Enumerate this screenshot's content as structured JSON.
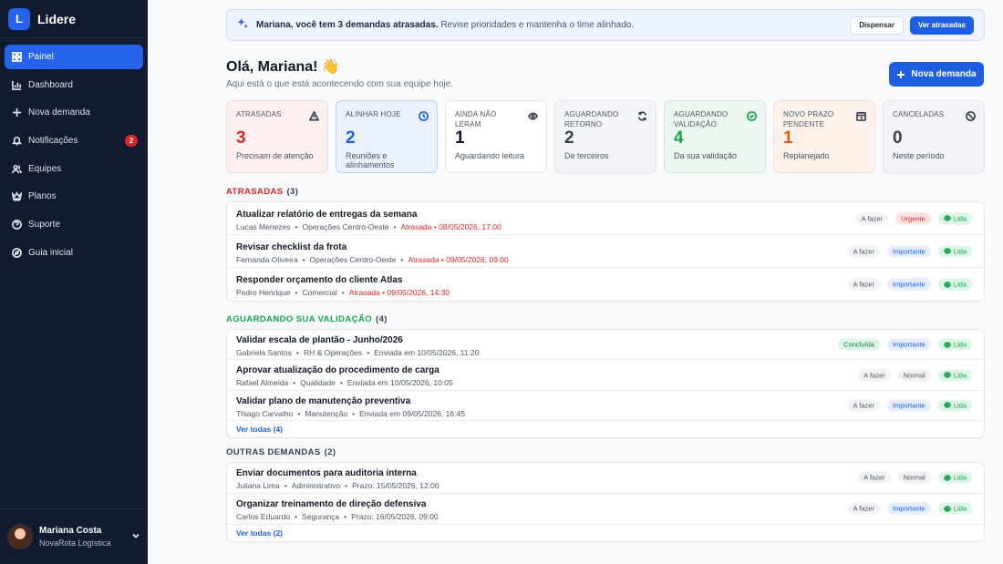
{
  "brand": {
    "logo_letter": "L",
    "name": "Lidere"
  },
  "sidebar": {
    "items": [
      {
        "label": "Painel",
        "icon": "grid-icon",
        "active": true
      },
      {
        "label": "Dashboard",
        "icon": "bar-chart-icon"
      },
      {
        "label": "Nova demanda",
        "icon": "plus-icon"
      },
      {
        "label": "Notificações",
        "icon": "bell-icon",
        "badge": "2"
      },
      {
        "label": "Equipes",
        "icon": "users-icon"
      },
      {
        "label": "Planos",
        "icon": "crown-icon"
      },
      {
        "label": "Suporte",
        "icon": "help-icon"
      },
      {
        "label": "Guia inicial",
        "icon": "compass-icon"
      }
    ],
    "user": {
      "name": "Mariana Costa",
      "org": "NovaRota Logística"
    }
  },
  "banner": {
    "bold": "Mariana, você tem 3 demandas atrasadas.",
    "text": "Revise prioridades e mantenha o time alinhado.",
    "dismiss": "Dispensar",
    "view": "Ver atrasadas"
  },
  "greeting": {
    "title": "Olá, Mariana! 👋",
    "subtitle": "Aqui está o que está acontecendo com sua equipe hoje."
  },
  "new_button": "Nova demanda",
  "cards": [
    {
      "label": "ATRASADAS",
      "value": "3",
      "sub": "Precisam de atenção",
      "color": "#dc2626",
      "bg": "#fdf0ee",
      "border": "#f5dcd6"
    },
    {
      "label": "ALINHAR HOJE",
      "value": "2",
      "sub": "Reuniões e alinhamentos",
      "color": "#1d5fe0",
      "bg": "#eaf1fc",
      "border": "#b9cdf3"
    },
    {
      "label": "AINDA NÃO LERAM",
      "value": "1",
      "sub": "Aguardando leitura",
      "color": "#111827",
      "bg": "#ffffff",
      "border": "#e3e6eb"
    },
    {
      "label": "AGUARDANDO RETORNO",
      "value": "2",
      "sub": "De terceiros",
      "color": "#374151",
      "bg": "#f2f4f7",
      "border": "#e3e6eb"
    },
    {
      "label": "AGUARDANDO VALIDAÇÃO",
      "value": "4",
      "sub": "Da sua validação",
      "color": "#16a34a",
      "bg": "#ecf7f0",
      "border": "#cdeadb"
    },
    {
      "label": "NOVO PRAZO PENDENTE",
      "value": "1",
      "sub": "Replanejado",
      "color": "#ea580c",
      "bg": "#fdf2ea",
      "border": "#f5decb"
    },
    {
      "label": "CANCELADAS",
      "value": "0",
      "sub": "Neste período",
      "color": "#374151",
      "bg": "#f2f4f7",
      "border": "#e3e6eb"
    }
  ],
  "sections": {
    "late": {
      "title": "ATRASADAS",
      "count": "(3)",
      "color": "#dc2626",
      "rows": [
        {
          "title": "Atualizar relatório de entregas da semana",
          "person": "Lucas Menezes",
          "team": "Operações Centro-Oeste",
          "status": "Atrasada • 08/05/2026, 17:00",
          "tags": [
            "A fazer",
            "Urgente",
            "Lida"
          ]
        },
        {
          "title": "Revisar checklist da frota",
          "person": "Fernanda Oliveira",
          "team": "Operações Centro-Oeste",
          "status": "Atrasada • 09/05/2026, 09:00",
          "tags": [
            "A fazer",
            "Importante",
            "Lida"
          ]
        },
        {
          "title": "Responder orçamento do cliente Atlas",
          "person": "Pedro Henrique",
          "team": "Comercial",
          "status": "Atrasada • 09/05/2026, 14:30",
          "tags": [
            "A fazer",
            "Importante",
            "Lida"
          ]
        }
      ]
    },
    "validation": {
      "title": "AGUARDANDO SUA VALIDAÇÃO",
      "count": "(4)",
      "color": "#16a34a",
      "rows": [
        {
          "title": "Validar escala de plantão - Junho/2026",
          "person": "Gabriela Santos",
          "team": "RH & Operações",
          "status": "Enviada em 10/05/2026, 11:20",
          "tags": [
            "Concluída",
            "Importante",
            "Lida"
          ]
        },
        {
          "title": "Aprovar atualização do procedimento de carga",
          "person": "Rafael Almeida",
          "team": "Qualidade",
          "status": "Enviada em 10/05/2026, 10:05",
          "tags": [
            "A fazer",
            "Normal",
            "Lida"
          ]
        },
        {
          "title": "Validar plano de manutenção preventiva",
          "person": "Thiago Carvalho",
          "team": "Manutenção",
          "status": "Enviada em 09/05/2026, 16:45",
          "tags": [
            "A fazer",
            "Importante",
            "Lida"
          ]
        }
      ],
      "see_all": "Ver todas (4)"
    },
    "other": {
      "title": "OUTRAS DEMANDAS",
      "count": "(2)",
      "color": "#374151",
      "rows": [
        {
          "title": "Enviar documentos para auditoria interna",
          "person": "Juliana Lima",
          "team": "Administrativo",
          "status": "Prazo: 15/05/2026, 12:00",
          "tags": [
            "A fazer",
            "Normal",
            "Lida"
          ]
        },
        {
          "title": "Organizar treinamento de direção defensiva",
          "person": "Carlos Eduardo",
          "team": "Segurança",
          "status": "Prazo: 16/05/2026, 09:00",
          "tags": [
            "A fazer",
            "Importante",
            "Lida"
          ]
        }
      ],
      "see_all": "Ver todas (2)"
    }
  }
}
